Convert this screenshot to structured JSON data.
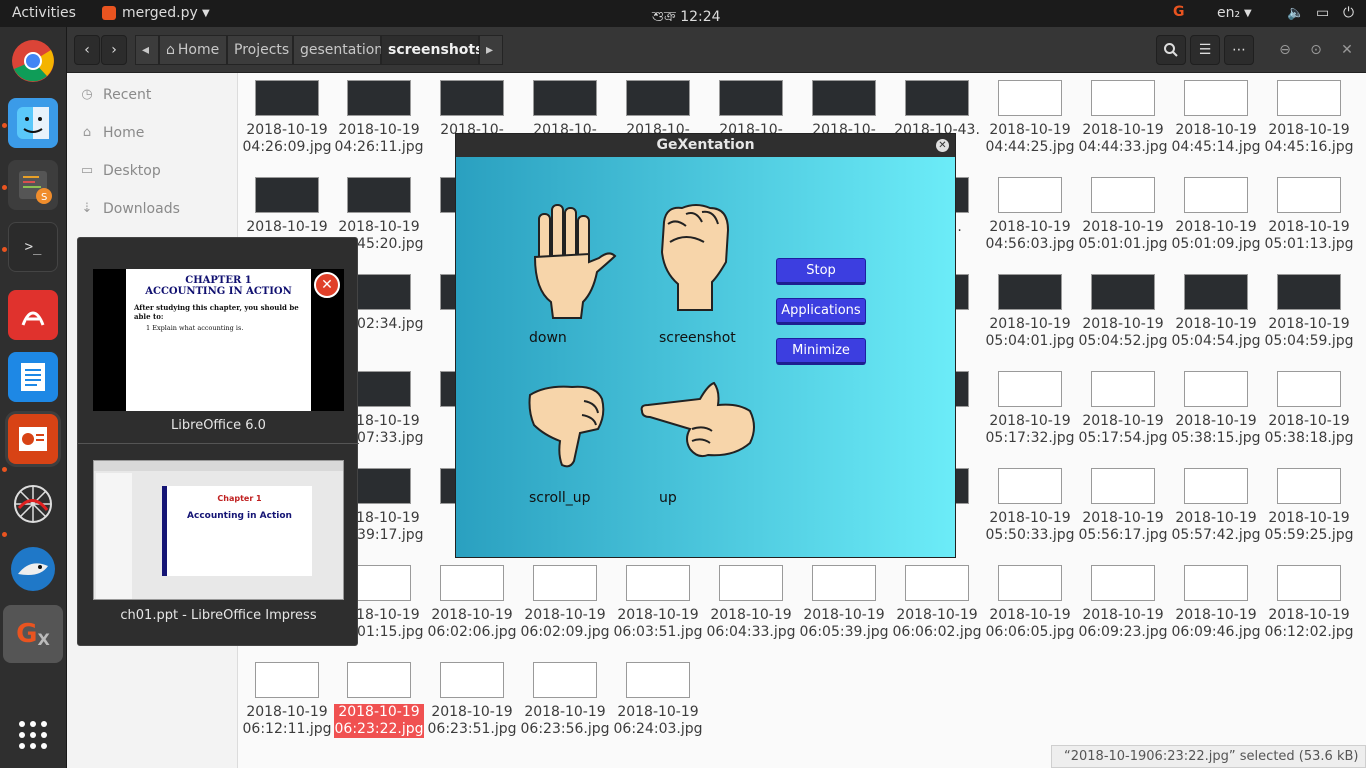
{
  "topbar": {
    "activities": "Activities",
    "app_name": "merged.py",
    "clock": "শুক্র 12:24",
    "lang": "en₂"
  },
  "dock": {
    "items": [
      "chrome",
      "finder",
      "sublime",
      "terminal",
      "pdf",
      "writer",
      "impress",
      "network",
      "wireshark",
      "gexentation",
      "apps-grid"
    ]
  },
  "files": {
    "nav": {
      "home": "Home",
      "crumbs": [
        "Projects",
        "gesentation",
        "screenshots"
      ]
    },
    "sidebar": {
      "recent": "Recent",
      "home": "Home",
      "desktop": "Desktop",
      "downloads": "Downloads"
    },
    "rows": [
      [
        "2018-10-1904:26:09.jpg",
        "2018-10-1904:26:11.jpg",
        "2018-10-",
        "2018-10-",
        "2018-10-",
        "2018-10-",
        "2018-10-",
        "2018-10-43.",
        "2018-10-1904:44:25.jpg",
        "2018-10-1904:44:33.jpg",
        "2018-10-1904:45:14.jpg",
        "2018-10-1904:45:16.jpg"
      ],
      [
        "2018-10-1904:45:18",
        "2018-10-1904:45:20.jpg",
        "",
        "",
        "",
        "",
        "",
        "0-1.01.",
        "2018-10-1904:56:03.jpg",
        "2018-10-1905:01:01.jpg",
        "2018-10-1905:01:09.jpg",
        "2018-10-1905:01:13.jpg"
      ],
      [
        "",
        "05:02:34.jpg",
        "",
        "",
        "",
        "",
        "",
        "0-.49.",
        "2018-10-1905:04:01.jpg",
        "2018-10-1905:04:52.jpg",
        "2018-10-1905:04:54.jpg",
        "2018-10-1905:04:59.jpg"
      ],
      [
        "",
        "2018-10-1905:07:33.jpg",
        "",
        "",
        "",
        "",
        "",
        "0-.31.",
        "2018-10-1905:17:32.jpg",
        "2018-10-1905:17:54.jpg",
        "2018-10-1905:38:15.jpg",
        "2018-10-1905:38:18.jpg"
      ],
      [
        "",
        "2018-10-1905:39:17.jpg",
        "",
        "",
        "",
        "",
        "",
        "0-.28.",
        "2018-10-1905:50:33.jpg",
        "2018-10-1905:56:17.jpg",
        "2018-10-1905:57:42.jpg",
        "2018-10-1905:59:25.jpg"
      ],
      [
        "",
        "2018-10-1906:01:15.jpg",
        "2018-10-1906:02:06.jpg",
        "2018-10-1906:02:09.jpg",
        "2018-10-1906:03:51.jpg",
        "2018-10-1906:04:33.jpg",
        "2018-10-1906:05:39.jpg",
        "2018-10-1906:06:02.jpg",
        "2018-10-1906:06:05.jpg",
        "2018-10-1906:09:23.jpg",
        "2018-10-1906:09:46.jpg",
        "2018-10-1906:12:02.jpg"
      ],
      [
        "2018-10-1906:12:11.jpg",
        "2018-10-1906:23:22.jpg",
        "2018-10-1906:23:51.jpg",
        "2018-10-1906:23:56.jpg",
        "2018-10-1906:24:03.jpg"
      ]
    ],
    "selected": "2018-10-1906:23:22.jpg",
    "status": "“2018-10-1906:23:22.jpg” selected  (53.6 kB)"
  },
  "popup": {
    "win1": "LibreOffice 6.0",
    "win2": "ch01.ppt - LibreOffice Impress",
    "slide1_title_a": "CHAPTER 1",
    "slide1_title_b": "ACCOUNTING IN ACTION",
    "slide1_text": "After studying this chapter, you should be able to:",
    "slide1_item": "1  Explain what accounting is.",
    "slide2_a": "Chapter 1",
    "slide2_b": "Accounting in Action"
  },
  "dialog": {
    "title": "GeXentation",
    "gestures": [
      {
        "label": "down"
      },
      {
        "label": "screenshot"
      },
      {
        "label": "scroll_up"
      },
      {
        "label": "up"
      }
    ],
    "buttons": {
      "stop": "Stop",
      "applications": "Applications",
      "minimize": "Minimize"
    }
  },
  "colors": {
    "accent": "#e95420",
    "selected": "#f05151",
    "dialog_btn": "#3c3ee0"
  }
}
